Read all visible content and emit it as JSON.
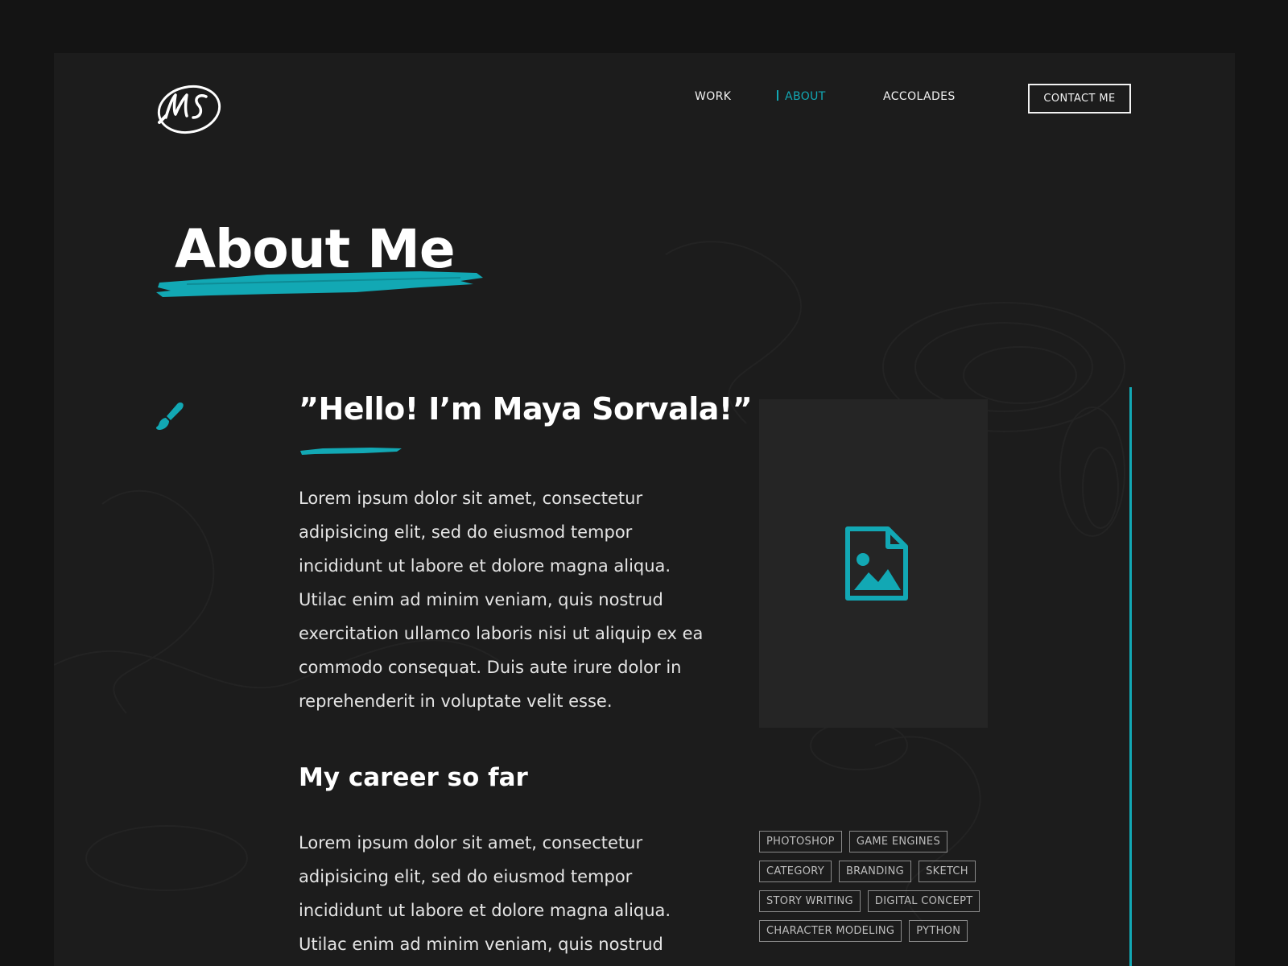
{
  "brand": {
    "logo_text": "MS"
  },
  "nav": {
    "items": [
      {
        "label": "WORK",
        "active": false
      },
      {
        "label": "ABOUT",
        "active": true
      },
      {
        "label": "ACCOLADES",
        "active": false
      }
    ],
    "contact_label": "CONTACT ME"
  },
  "page": {
    "title": "About Me"
  },
  "intro": {
    "greeting": "”Hello! I’m Maya Sorvala!”",
    "paragraph": "Lorem ipsum dolor sit amet, consectetur adipisicing elit, sed do eiusmod tempor incididunt ut labore et dolore magna aliqua. Utilac enim ad minim veniam, quis nostrud exercitation ullamco laboris nisi ut aliquip ex ea commodo consequat. Duis aute irure dolor in reprehenderit in voluptate velit esse."
  },
  "career": {
    "heading": "My career so far",
    "paragraph": "Lorem ipsum dolor sit amet, consectetur adipisicing elit, sed do eiusmod tempor incididunt ut labore et dolore magna aliqua. Utilac enim ad minim veniam, quis nostrud"
  },
  "tags": {
    "rows": [
      [
        "PHOTOSHOP",
        "GAME ENGINES"
      ],
      [
        "CATEGORY",
        "BRANDING",
        "SKETCH"
      ],
      [
        "STORY WRITING",
        "DIGITAL CONCEPT"
      ],
      [
        "CHARACTER MODELING",
        "PYTHON"
      ]
    ]
  },
  "icons": {
    "logo": "ms-monogram-logo",
    "brush": "paintbrush-icon",
    "image_placeholder": "image-file-icon"
  },
  "colors": {
    "accent": "#12a8b4",
    "page_background": "#1c1c1c",
    "outer_background": "#141414",
    "text": "#ffffff"
  }
}
